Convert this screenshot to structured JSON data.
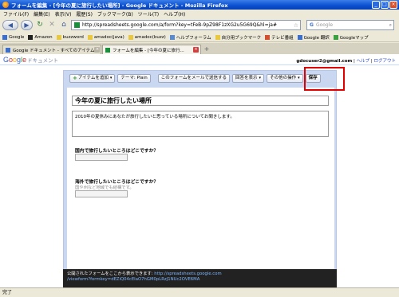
{
  "window": {
    "title": "フォームを編集 - [今年の夏に旅行したい場所] - Google ドキュメント - Mozilla Firefox"
  },
  "menu": [
    "ファイル(F)",
    "編集(E)",
    "表示(V)",
    "履歴(S)",
    "ブックマーク(B)",
    "ツール(T)",
    "ヘルプ(H)"
  ],
  "nav": {
    "url": "http://spreadsheets.google.com/a/form?key=tFeB-9pZ98F1zXG2u5G69Q&hl=ja#",
    "search_placeholder": "Google"
  },
  "bookmarks": [
    "Google",
    "Amazon",
    "buzzword",
    "amadoc(java)",
    "amadoc(buzz)",
    "ヘルプフォーラム",
    "自分用ブックマーク",
    "テレビ番組",
    "Google 翻訳",
    "Googleマップ"
  ],
  "tabs": [
    {
      "label": "Google ドキュメント - すべてのアイテム"
    },
    {
      "label": "フォームを編集 - [今年の夏に旅行..."
    }
  ],
  "header": {
    "logo": "Google",
    "product": "ドキュメント",
    "email": "gdocuser2@gmail.com",
    "help": "ヘルプ",
    "logout": "ログアウト"
  },
  "toolbar": {
    "add_item": "アイテムを追加",
    "theme": "テーマ: Plain",
    "email_form": "このフォームをメールで送信する",
    "view_responses": "回答を表示",
    "more_actions": "その他の操作",
    "save": "保存"
  },
  "form": {
    "title": "今年の夏に旅行したい場所",
    "description": "2010年の夏休みにあなたが旅行したいと思っている場所についてお聞きします。",
    "q1_label": "国内で旅行したいところはどこですか？",
    "q2_label": "海外で旅行したいところはどこですか？",
    "q2_help": "国や州など地域でも結構です。"
  },
  "footer": {
    "text": "公開されたフォームをここから表示できます: ",
    "link1": "http://spreadsheets.google.com",
    "link2": "/viewform?formkey=dEZiQ04cEIaO7hGM0pLRzJ1NUc2OVE6MA"
  },
  "status": "完了"
}
